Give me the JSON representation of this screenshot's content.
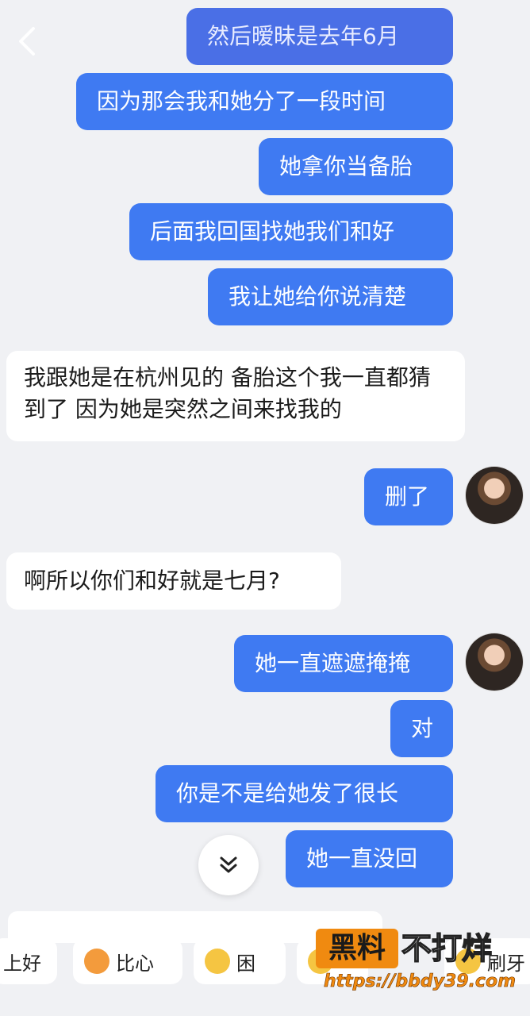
{
  "header": {
    "back_icon": "chevron-left-icon"
  },
  "messages": [
    {
      "side": "out",
      "text": "然后暧昧是去年6月"
    },
    {
      "side": "out",
      "text": "因为那会我和她分了一段时间"
    },
    {
      "side": "out",
      "text": "她拿你当备胎"
    },
    {
      "side": "out",
      "text": "后面我回国找她我们和好"
    },
    {
      "side": "out",
      "text": "我让她给你说清楚"
    },
    {
      "side": "in",
      "text": "我跟她是在杭州见的 备胎这个我一直都猜到了 因为她是突然之间来找我的"
    },
    {
      "side": "out",
      "text": "删了"
    },
    {
      "side": "in",
      "text": "啊所以你们和好就是七月?"
    },
    {
      "side": "out",
      "text": "她一直遮遮掩掩"
    },
    {
      "side": "out",
      "text": "对"
    },
    {
      "side": "out",
      "text": "你是不是给她发了很长"
    },
    {
      "side": "out",
      "text": "她一直没回"
    }
  ],
  "scroll_button": {
    "icon": "double-chevron-down-icon"
  },
  "quick_replies": [
    {
      "label": "上好",
      "icon": ""
    },
    {
      "label": "比心",
      "icon": "heart-hands-emoji-icon"
    },
    {
      "label": "困",
      "icon": "sleepy-emoji-icon"
    },
    {
      "label": "",
      "icon": "emoji-icon"
    },
    {
      "label": "刷牙",
      "icon": "emoji-icon"
    }
  ],
  "watermark": {
    "box_text": "黑料",
    "text": "不打烊",
    "url": "https://bbdy39.com"
  },
  "colors": {
    "outgoing_bubble": "#3f7af2",
    "incoming_bubble": "#ffffff",
    "background": "#f0f1f4",
    "watermark_orange": "#f08a10"
  }
}
